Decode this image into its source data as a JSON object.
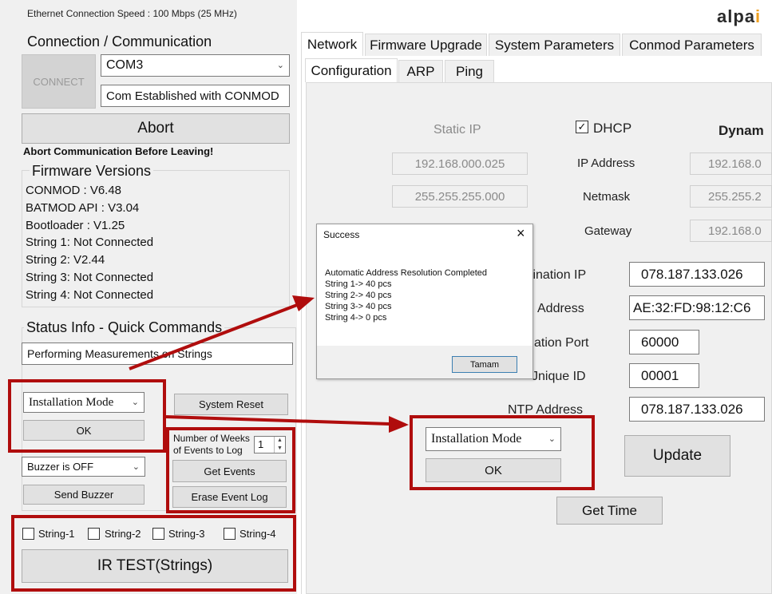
{
  "header": {
    "ethernet_speed": "Ethernet Connection Speed : 100 Mbps (25 MHz)",
    "logo": "alpa"
  },
  "connection": {
    "title": "Connection / Communication",
    "connect_label": "CONNECT",
    "port": "COM3",
    "status": "Com Established with CONMOD",
    "abort_label": "Abort",
    "abort_note": "Abort Communication Before Leaving!"
  },
  "firmware": {
    "title": "Firmware Versions",
    "lines": [
      "CONMOD      : V6.48",
      "BATMOD API  : V3.04",
      "Bootloader    : V1.25",
      "String 1: Not Connected",
      "String 2: V2.44",
      "String 3: Not Connected",
      "String 4: Not Connected"
    ]
  },
  "status": {
    "title": "Status Info - Quick Commands",
    "message": "Performing Measurements on Strings",
    "mode_select": "Installation Mode",
    "ok_label": "OK",
    "system_reset": "System Reset",
    "weeks_label": "Number of Weeks of Events to Log",
    "weeks_value": "1",
    "get_events": "Get Events",
    "erase_event_log": "Erase Event Log",
    "buzzer_select": "Buzzer is OFF",
    "send_buzzer": "Send Buzzer",
    "strings": [
      "String-1",
      "String-2",
      "String-3",
      "String-4"
    ],
    "ir_test": "IR TEST(Strings)"
  },
  "tabs": {
    "top": [
      "Network",
      "Firmware Upgrade",
      "System Parameters",
      "Conmod Parameters"
    ],
    "sub": [
      "Configuration",
      "ARP",
      "Ping"
    ]
  },
  "network": {
    "static_ip_label": "Static IP",
    "dhcp_label": "DHCP",
    "dhcp_checked": "☑",
    "dynamic_label": "Dynam",
    "ip_address_label": "IP Address",
    "netmask_label": "Netmask",
    "gateway_label": "Gateway",
    "static_ip": "192.168.000.025",
    "static_netmask": "255.255.255.000",
    "dyn_ip": "192.168.0",
    "dyn_netmask": "255.255.2",
    "dyn_gateway": "192.168.0",
    "destination_ip_label": "tination IP",
    "destination_ip": "078.187.133.026",
    "mac_label": "Address",
    "mac": "AE:32:FD:98:12:C6",
    "port_label": "ation Port",
    "port": "60000",
    "unique_id_label": "Jnique ID",
    "unique_id": "00001",
    "ntp_label": "NTP Address",
    "ntp": "078.187.133.026",
    "update_label": "Update",
    "get_time_label": "Get Time"
  },
  "zoom": {
    "mode_select": "Installation Mode",
    "ok_label": "OK"
  },
  "dialog": {
    "title": "Success",
    "lines": [
      "Automatic Address Resolution Completed",
      "String 1-> 40 pcs",
      "String 2-> 40 pcs",
      "String 3-> 40 pcs",
      "String 4-> 0 pcs"
    ],
    "button": "Tamam"
  },
  "colors": {
    "highlight": "#b00d0d",
    "logo_orange": "#f0a020"
  }
}
